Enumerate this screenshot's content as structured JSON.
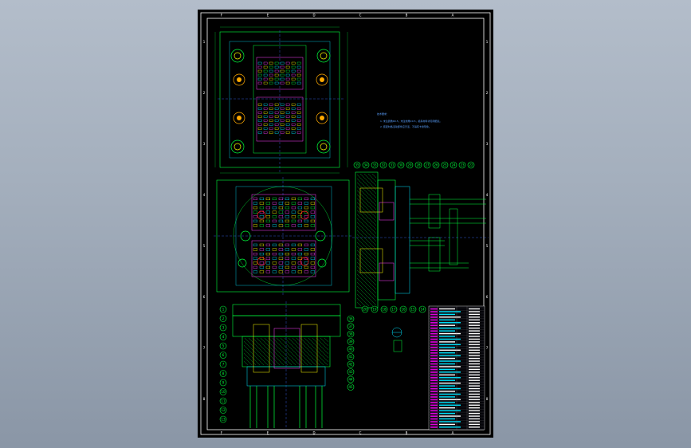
{
  "colors": {
    "background": "#a4afbd",
    "sheet": "#000000",
    "frame": "#ffffff",
    "line_green": "#00ff3c",
    "line_cyan": "#00e5ff",
    "line_yellow": "#ffff00",
    "line_magenta": "#ff40ff",
    "line_red": "#ff2020",
    "line_blue": "#3b6bff",
    "table_magenta": "#e000e0"
  },
  "frame": {
    "top_zones": [
      "F",
      "E",
      "D",
      "C",
      "B",
      "A"
    ],
    "side_zones": [
      "1",
      "2",
      "3",
      "4",
      "5",
      "6",
      "7",
      "8"
    ]
  },
  "notes": {
    "title": "技术要求：",
    "line1": "1. 未注圆角R0.5，未注倒角C0.5，模具材料详见明细表。",
    "line2": "2. 装配时各活动部件应灵活，不得有卡滞现象。"
  },
  "balloons": {
    "top_row": [
      "35",
      "34",
      "33",
      "32",
      "31",
      "30",
      "29",
      "28",
      "27",
      "26",
      "25",
      "24",
      "23",
      "22"
    ],
    "left_column": [
      "1",
      "2",
      "3",
      "4",
      "5",
      "6",
      "7",
      "8",
      "9",
      "10",
      "11",
      "12",
      "13"
    ],
    "right_column": [
      "36",
      "37",
      "38",
      "39",
      "40",
      "41",
      "42",
      "43",
      "44",
      "45"
    ],
    "section_bottom": [
      "20",
      "19",
      "18",
      "17",
      "16",
      "15",
      "14"
    ]
  },
  "icons": [
    "cad-drawing-icon"
  ]
}
